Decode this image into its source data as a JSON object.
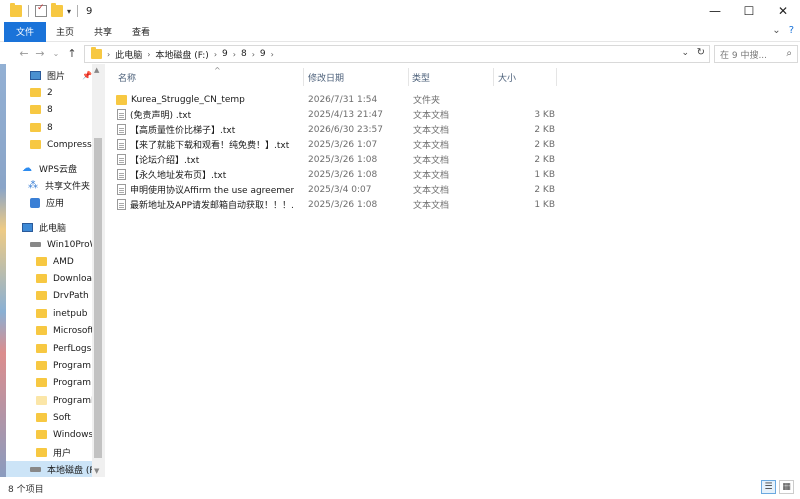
{
  "window": {
    "title": "9",
    "controls": {
      "minimize": "—",
      "maximize": "☐",
      "close": "✕"
    }
  },
  "ribbon": {
    "tabs": [
      "文件",
      "主页",
      "共享",
      "查看"
    ],
    "collapse_icon": "chevron-down-icon",
    "help_icon": "help-icon"
  },
  "address": {
    "crumbs": [
      "此电脑",
      "本地磁盘 (F:)",
      "9",
      "8",
      "9"
    ],
    "search_placeholder": "在 9 中搜..."
  },
  "nav": {
    "items": [
      {
        "label": "图片",
        "icon": "pictures-icon",
        "pinned": true
      },
      {
        "label": "2",
        "icon": "folder-icon"
      },
      {
        "label": "8",
        "icon": "folder-icon"
      },
      {
        "label": "8",
        "icon": "folder-icon"
      },
      {
        "label": "Compresse",
        "icon": "folder-icon"
      },
      {
        "label": "WPS云盘",
        "icon": "cloud-icon"
      },
      {
        "label": "共享文件夹",
        "icon": "share-icon"
      },
      {
        "label": "应用",
        "icon": "app-icon"
      },
      {
        "label": "此电脑",
        "icon": "pc-icon"
      },
      {
        "label": "Win10ProW",
        "icon": "drive-icon"
      },
      {
        "label": "AMD",
        "icon": "folder-icon"
      },
      {
        "label": "Downloa",
        "icon": "folder-icon"
      },
      {
        "label": "DrvPath",
        "icon": "folder-icon"
      },
      {
        "label": "inetpub",
        "icon": "folder-icon"
      },
      {
        "label": "Microsoft",
        "icon": "folder-icon"
      },
      {
        "label": "PerfLogs",
        "icon": "folder-icon"
      },
      {
        "label": "Program I",
        "icon": "folder-icon"
      },
      {
        "label": "Program I",
        "icon": "folder-icon"
      },
      {
        "label": "ProgramD",
        "icon": "folder-icon"
      },
      {
        "label": "Soft",
        "icon": "folder-icon"
      },
      {
        "label": "Windows",
        "icon": "folder-icon"
      },
      {
        "label": "用户",
        "icon": "folder-icon"
      },
      {
        "label": "本地磁盘 (F:",
        "icon": "drive-icon",
        "selected": true
      }
    ]
  },
  "columns": {
    "name": "名称",
    "date": "修改日期",
    "type": "类型",
    "size": "大小"
  },
  "files": [
    {
      "name": "Kurea_Struggle_CN_temp",
      "date": "2026/7/31 1:54",
      "type": "文件夹",
      "size": "",
      "kind": "folder"
    },
    {
      "name": "(免责声明) .txt",
      "date": "2025/4/13 21:47",
      "type": "文本文档",
      "size": "3 KB",
      "kind": "doc"
    },
    {
      "name": "【高质量性价比梯子】.txt",
      "date": "2026/6/30 23:57",
      "type": "文本文档",
      "size": "2 KB",
      "kind": "doc"
    },
    {
      "name": "【来了就能下载和观看！纯免费！】.txt",
      "date": "2025/3/26 1:07",
      "type": "文本文档",
      "size": "2 KB",
      "kind": "doc"
    },
    {
      "name": "【论坛介绍】.txt",
      "date": "2025/3/26 1:08",
      "type": "文本文档",
      "size": "2 KB",
      "kind": "doc"
    },
    {
      "name": "【永久地址发布页】.txt",
      "date": "2025/3/26 1:08",
      "type": "文本文档",
      "size": "1 KB",
      "kind": "doc"
    },
    {
      "name": "申明使用协议Affirm the use agreemen...",
      "date": "2025/3/4 0:07",
      "type": "文本文档",
      "size": "2 KB",
      "kind": "doc"
    },
    {
      "name": "最新地址及APP请发邮箱自动获取！！！....",
      "date": "2025/3/26 1:08",
      "type": "文本文档",
      "size": "1 KB",
      "kind": "doc"
    }
  ],
  "status": {
    "count": "8 个项目"
  }
}
